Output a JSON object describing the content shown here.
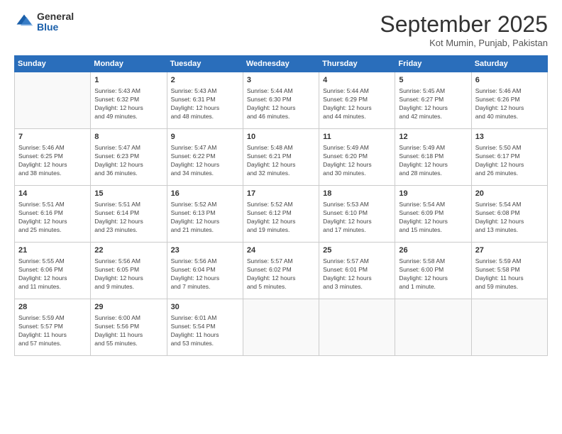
{
  "header": {
    "logo_general": "General",
    "logo_blue": "Blue",
    "title": "September 2025",
    "location": "Kot Mumin, Punjab, Pakistan"
  },
  "days_of_week": [
    "Sunday",
    "Monday",
    "Tuesday",
    "Wednesday",
    "Thursday",
    "Friday",
    "Saturday"
  ],
  "weeks": [
    [
      {
        "day": "",
        "info": ""
      },
      {
        "day": "1",
        "info": "Sunrise: 5:43 AM\nSunset: 6:32 PM\nDaylight: 12 hours\nand 49 minutes."
      },
      {
        "day": "2",
        "info": "Sunrise: 5:43 AM\nSunset: 6:31 PM\nDaylight: 12 hours\nand 48 minutes."
      },
      {
        "day": "3",
        "info": "Sunrise: 5:44 AM\nSunset: 6:30 PM\nDaylight: 12 hours\nand 46 minutes."
      },
      {
        "day": "4",
        "info": "Sunrise: 5:44 AM\nSunset: 6:29 PM\nDaylight: 12 hours\nand 44 minutes."
      },
      {
        "day": "5",
        "info": "Sunrise: 5:45 AM\nSunset: 6:27 PM\nDaylight: 12 hours\nand 42 minutes."
      },
      {
        "day": "6",
        "info": "Sunrise: 5:46 AM\nSunset: 6:26 PM\nDaylight: 12 hours\nand 40 minutes."
      }
    ],
    [
      {
        "day": "7",
        "info": "Sunrise: 5:46 AM\nSunset: 6:25 PM\nDaylight: 12 hours\nand 38 minutes."
      },
      {
        "day": "8",
        "info": "Sunrise: 5:47 AM\nSunset: 6:23 PM\nDaylight: 12 hours\nand 36 minutes."
      },
      {
        "day": "9",
        "info": "Sunrise: 5:47 AM\nSunset: 6:22 PM\nDaylight: 12 hours\nand 34 minutes."
      },
      {
        "day": "10",
        "info": "Sunrise: 5:48 AM\nSunset: 6:21 PM\nDaylight: 12 hours\nand 32 minutes."
      },
      {
        "day": "11",
        "info": "Sunrise: 5:49 AM\nSunset: 6:20 PM\nDaylight: 12 hours\nand 30 minutes."
      },
      {
        "day": "12",
        "info": "Sunrise: 5:49 AM\nSunset: 6:18 PM\nDaylight: 12 hours\nand 28 minutes."
      },
      {
        "day": "13",
        "info": "Sunrise: 5:50 AM\nSunset: 6:17 PM\nDaylight: 12 hours\nand 26 minutes."
      }
    ],
    [
      {
        "day": "14",
        "info": "Sunrise: 5:51 AM\nSunset: 6:16 PM\nDaylight: 12 hours\nand 25 minutes."
      },
      {
        "day": "15",
        "info": "Sunrise: 5:51 AM\nSunset: 6:14 PM\nDaylight: 12 hours\nand 23 minutes."
      },
      {
        "day": "16",
        "info": "Sunrise: 5:52 AM\nSunset: 6:13 PM\nDaylight: 12 hours\nand 21 minutes."
      },
      {
        "day": "17",
        "info": "Sunrise: 5:52 AM\nSunset: 6:12 PM\nDaylight: 12 hours\nand 19 minutes."
      },
      {
        "day": "18",
        "info": "Sunrise: 5:53 AM\nSunset: 6:10 PM\nDaylight: 12 hours\nand 17 minutes."
      },
      {
        "day": "19",
        "info": "Sunrise: 5:54 AM\nSunset: 6:09 PM\nDaylight: 12 hours\nand 15 minutes."
      },
      {
        "day": "20",
        "info": "Sunrise: 5:54 AM\nSunset: 6:08 PM\nDaylight: 12 hours\nand 13 minutes."
      }
    ],
    [
      {
        "day": "21",
        "info": "Sunrise: 5:55 AM\nSunset: 6:06 PM\nDaylight: 12 hours\nand 11 minutes."
      },
      {
        "day": "22",
        "info": "Sunrise: 5:56 AM\nSunset: 6:05 PM\nDaylight: 12 hours\nand 9 minutes."
      },
      {
        "day": "23",
        "info": "Sunrise: 5:56 AM\nSunset: 6:04 PM\nDaylight: 12 hours\nand 7 minutes."
      },
      {
        "day": "24",
        "info": "Sunrise: 5:57 AM\nSunset: 6:02 PM\nDaylight: 12 hours\nand 5 minutes."
      },
      {
        "day": "25",
        "info": "Sunrise: 5:57 AM\nSunset: 6:01 PM\nDaylight: 12 hours\nand 3 minutes."
      },
      {
        "day": "26",
        "info": "Sunrise: 5:58 AM\nSunset: 6:00 PM\nDaylight: 12 hours\nand 1 minute."
      },
      {
        "day": "27",
        "info": "Sunrise: 5:59 AM\nSunset: 5:58 PM\nDaylight: 11 hours\nand 59 minutes."
      }
    ],
    [
      {
        "day": "28",
        "info": "Sunrise: 5:59 AM\nSunset: 5:57 PM\nDaylight: 11 hours\nand 57 minutes."
      },
      {
        "day": "29",
        "info": "Sunrise: 6:00 AM\nSunset: 5:56 PM\nDaylight: 11 hours\nand 55 minutes."
      },
      {
        "day": "30",
        "info": "Sunrise: 6:01 AM\nSunset: 5:54 PM\nDaylight: 11 hours\nand 53 minutes."
      },
      {
        "day": "",
        "info": ""
      },
      {
        "day": "",
        "info": ""
      },
      {
        "day": "",
        "info": ""
      },
      {
        "day": "",
        "info": ""
      }
    ]
  ]
}
